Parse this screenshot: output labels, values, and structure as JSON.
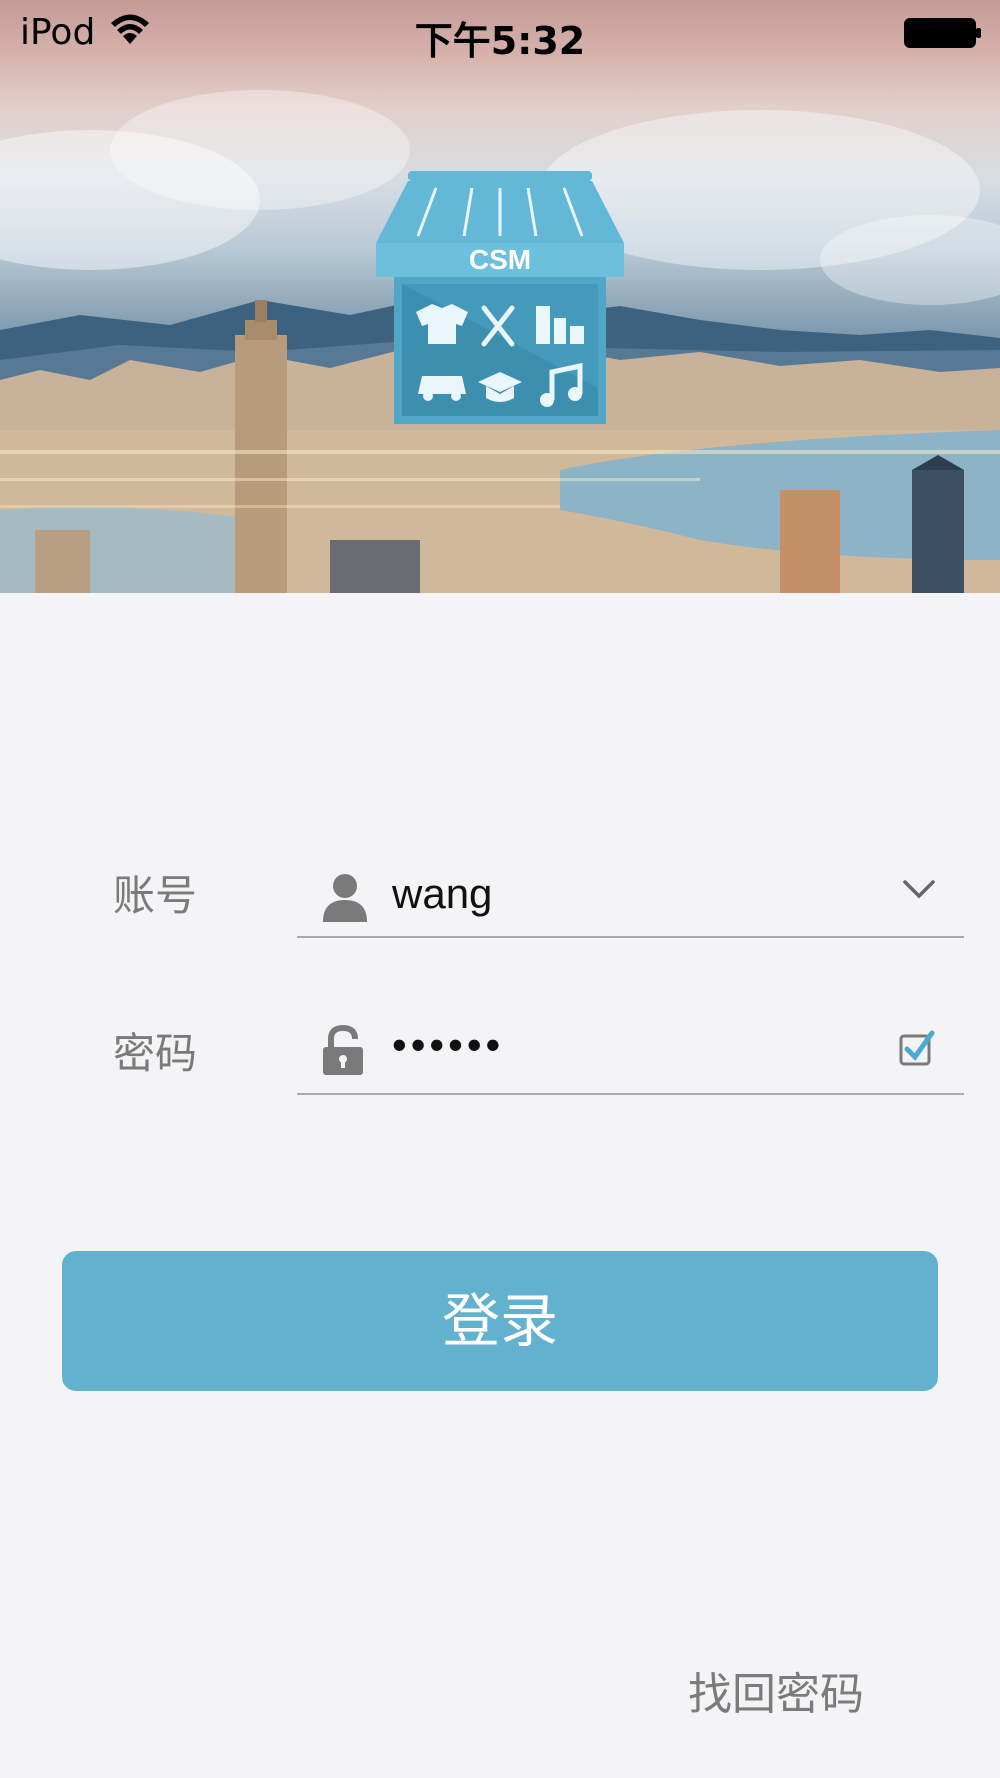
{
  "status_bar": {
    "carrier": "iPod",
    "time": "下午5:32"
  },
  "logo": {
    "text": "CSM"
  },
  "form": {
    "account_label": "账号",
    "account_value": "wang",
    "password_label": "密码",
    "password_value": "••••••",
    "remember_password": true
  },
  "login_button": "登录",
  "forgot_password": "找回密码",
  "colors": {
    "accent": "#62b2cf",
    "background": "#f4f4f6"
  },
  "icons": {
    "wifi": "wifi-icon",
    "battery": "battery-icon",
    "account": "user-icon",
    "dropdown": "chevron-down-icon",
    "password": "unlock-icon",
    "remember": "checkbox-icon"
  }
}
